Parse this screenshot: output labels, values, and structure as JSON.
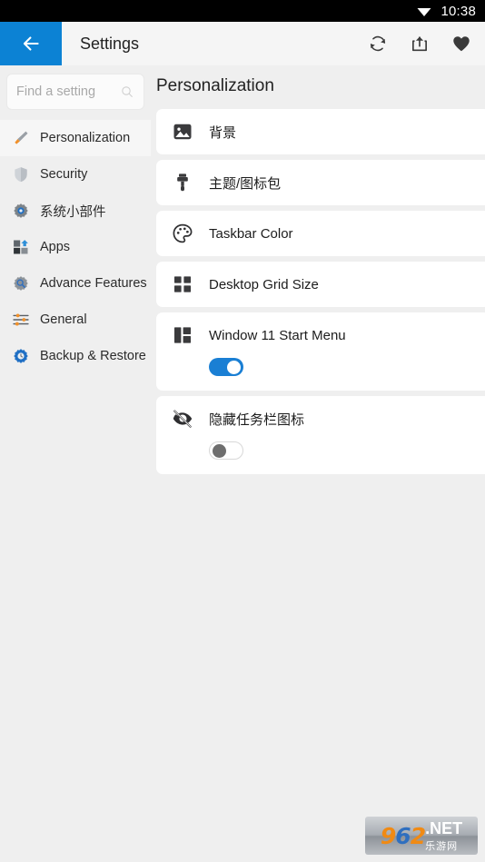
{
  "statusbar": {
    "wifi_icon": "wifi-icon",
    "time": "10:38"
  },
  "appbar": {
    "back_icon": "arrow-left-icon",
    "title": "Settings",
    "actions": [
      {
        "icon": "refresh-icon",
        "name": "refresh-button"
      },
      {
        "icon": "share-icon",
        "name": "share-button"
      },
      {
        "icon": "heart-icon",
        "name": "favorite-button"
      }
    ]
  },
  "search": {
    "placeholder": "Find a setting",
    "value": "",
    "icon": "search-icon"
  },
  "sidebar": {
    "items": [
      {
        "label": "Personalization",
        "icon": "paintbrush-icon",
        "selected": true
      },
      {
        "label": "Security",
        "icon": "shield-icon",
        "selected": false
      },
      {
        "label": "系统小部件",
        "icon": "gear-icon",
        "selected": false
      },
      {
        "label": "Apps",
        "icon": "apps-icon",
        "selected": false
      },
      {
        "label": "Advance Features",
        "icon": "gear-search-icon",
        "selected": false
      },
      {
        "label": "General",
        "icon": "sliders-icon",
        "selected": false
      },
      {
        "label": "Backup & Restore",
        "icon": "gear-backup-icon",
        "selected": false
      }
    ]
  },
  "main": {
    "title": "Personalization",
    "cards": [
      {
        "label": "背景",
        "icon": "image-icon",
        "toggle": null
      },
      {
        "label": "主题/图标包",
        "icon": "paintbrush-filled-icon",
        "toggle": null
      },
      {
        "label": "Taskbar Color",
        "icon": "palette-icon",
        "toggle": null
      },
      {
        "label": "Desktop Grid Size",
        "icon": "grid-icon",
        "toggle": null
      },
      {
        "label": "Window 11 Start Menu",
        "icon": "start-menu-icon",
        "toggle": "on"
      },
      {
        "label": "隐藏任务栏图标",
        "icon": "eye-off-icon",
        "toggle": "off"
      }
    ]
  },
  "watermark": {
    "digits_9": "9",
    "digits_6": "6",
    "digits_2": "2",
    "dot_net": ".NET",
    "cn_text": "乐游网"
  },
  "colors": {
    "accent_blue": "#0c82d4",
    "toggle_on": "#1a7fd4",
    "page_bg": "#efefef",
    "card_bg": "#ffffff",
    "statusbar_bg": "#000000"
  }
}
